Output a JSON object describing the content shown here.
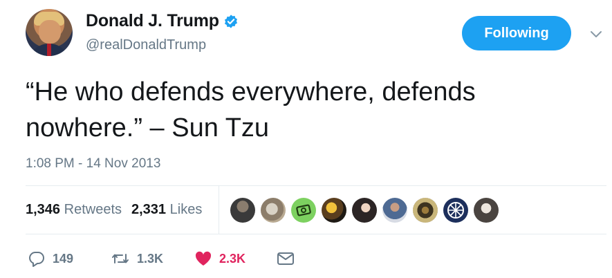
{
  "user": {
    "display_name": "Donald J. Trump",
    "handle": "@realDonaldTrump",
    "verified": true
  },
  "follow_button": {
    "label": "Following"
  },
  "tweet": {
    "text": "“He who defends everywhere, defends nowhere.” – Sun Tzu",
    "timestamp": "1:08 PM - 14 Nov 2013"
  },
  "stats": {
    "retweets_count": "1,346",
    "retweets_label": "Retweets",
    "likes_count": "2,331",
    "likes_label": "Likes"
  },
  "actions": {
    "reply_count": "149",
    "retweet_count": "1.3K",
    "like_count": "2.3K"
  },
  "colors": {
    "accent": "#1da1f2",
    "muted_text": "#657786",
    "like": "#e0245e",
    "divider": "#e6ecf0"
  },
  "icons": [
    "verified-badge-icon",
    "chevron-down-icon",
    "reply-icon",
    "retweet-icon",
    "heart-icon",
    "message-icon"
  ]
}
